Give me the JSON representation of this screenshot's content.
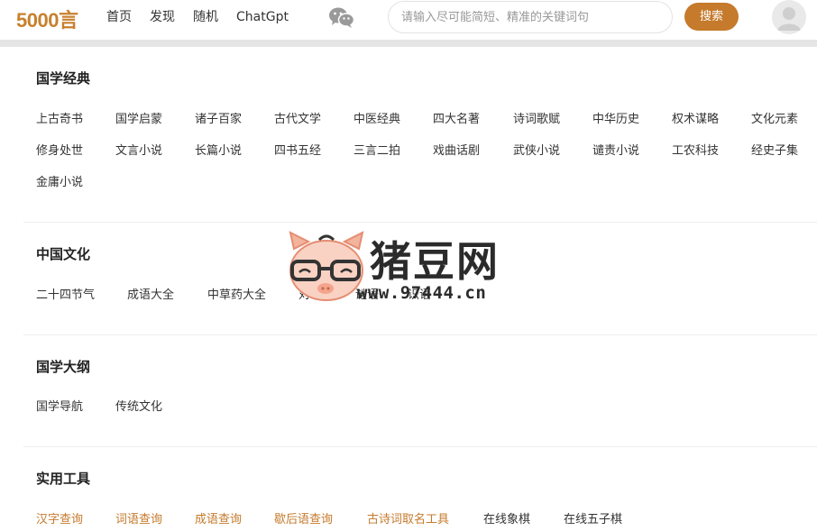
{
  "header": {
    "logo": "5000言",
    "nav": [
      "首页",
      "发现",
      "随机",
      "ChatGpt"
    ],
    "search_placeholder": "请输入尽可能简短、精准的关键词句",
    "search_label": "搜索"
  },
  "sections": [
    {
      "title": "国学经典",
      "links": [
        [
          "上古奇书",
          "国学启蒙",
          "诸子百家",
          "古代文学",
          "中医经典",
          "四大名著",
          "诗词歌赋",
          "中华历史",
          "权术谋略",
          "文化元素"
        ],
        [
          "修身处世",
          "文言小说",
          "长篇小说",
          "四书五经",
          "三言二拍",
          "戏曲话剧",
          "武侠小说",
          "谴责小说",
          "工农科技",
          "经史子集"
        ],
        [
          "金庸小说"
        ]
      ]
    },
    {
      "title": "中国文化",
      "links": [
        [
          "二十四节气",
          "成语大全",
          "中草药大全",
          "对联",
          "谜语",
          "识语"
        ]
      ]
    },
    {
      "title": "国学大纲",
      "links": [
        [
          "国学导航",
          "传统文化"
        ]
      ]
    },
    {
      "title": "实用工具",
      "links": [
        [
          "汉字查询",
          "词语查询",
          "成语查询",
          "歇后语查询",
          "古诗词取名工具",
          "在线象棋",
          "在线五子棋"
        ]
      ]
    }
  ],
  "watermark": {
    "text": "猪豆网",
    "url": "www.97444.cn"
  },
  "colors": {
    "accent": "#c57a2c",
    "logo": "#c8802e",
    "text": "#333333"
  },
  "icons": [
    "wechat-icon",
    "user-avatar-icon",
    "pig-mascot-logo"
  ]
}
